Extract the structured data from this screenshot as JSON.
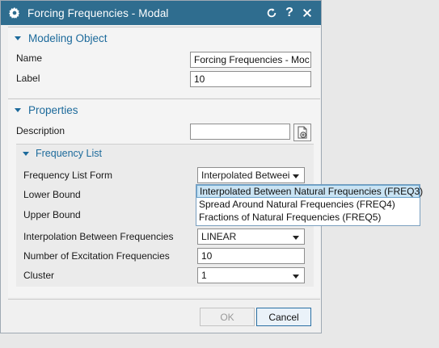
{
  "window": {
    "title": "Forcing Frequencies - Modal"
  },
  "modeling_object": {
    "header": "Modeling Object",
    "name_label": "Name",
    "name_value": "Forcing Frequencies - Moc",
    "label_label": "Label",
    "label_value": "10"
  },
  "properties": {
    "header": "Properties",
    "description_label": "Description",
    "description_value": "",
    "frequency_list": {
      "header": "Frequency List",
      "form_label": "Frequency List Form",
      "form_value": "Interpolated Betweei",
      "lower_bound_label": "Lower Bound",
      "upper_bound_label": "Upper Bound",
      "interp_label": "Interpolation Between Frequencies",
      "interp_value": "LINEAR",
      "num_exc_label": "Number of Excitation Frequencies",
      "num_exc_value": "10",
      "cluster_label": "Cluster",
      "cluster_value": "1"
    }
  },
  "dropdown_options": [
    "Interpolated Between Natural Frequencies (FREQ3)",
    "Spread Around Natural Frequencies (FREQ4)",
    "Fractions of Natural Frequencies (FREQ5)"
  ],
  "buttons": {
    "ok": "OK",
    "cancel": "Cancel"
  },
  "icons": {
    "settings": "gear-icon",
    "reset": "reset-icon",
    "help": "help-icon",
    "close": "close-icon",
    "attach": "attach-icon"
  },
  "colors": {
    "titlebar": "#2f6d8f",
    "section_header": "#1c6a9b"
  }
}
